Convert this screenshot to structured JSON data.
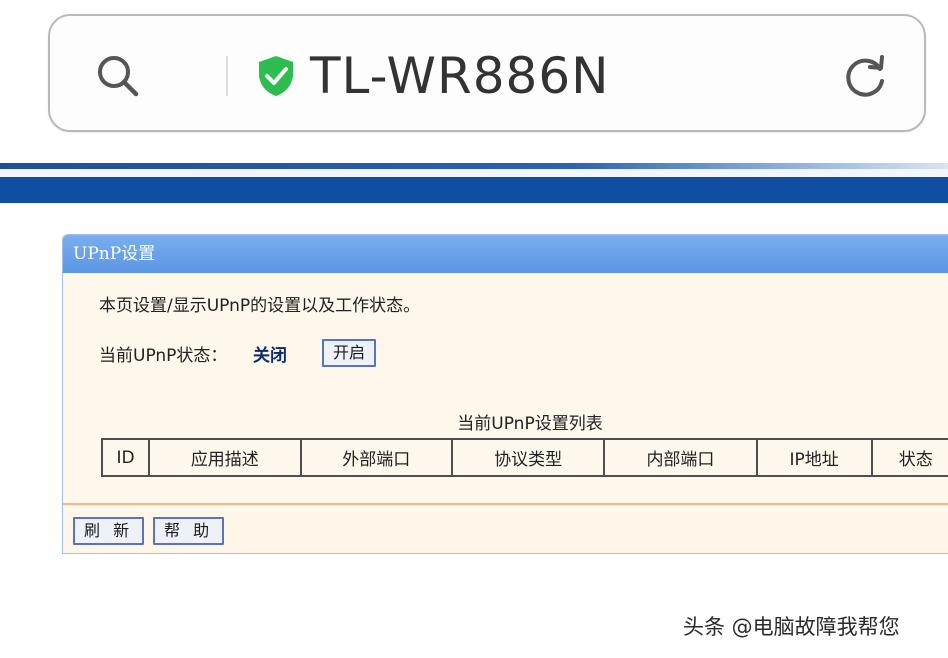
{
  "address_bar": {
    "title": "TL-WR886N",
    "icons": {
      "search": "search-icon",
      "secure": "shield-check-icon",
      "reload": "reload-icon"
    },
    "colors": {
      "shield": "#2dbd4e",
      "title": "#333333"
    }
  },
  "panel": {
    "title": "UPnP设置",
    "description": "本页设置/显示UPnP的设置以及工作状态。",
    "status_label": "当前UPnP状态：",
    "status_value": "关闭",
    "enable_button": "开启",
    "list_caption": "当前UPnP设置列表",
    "table_headers": [
      "ID",
      "应用描述",
      "外部端口",
      "协议类型",
      "内部端口",
      "IP地址",
      "状态"
    ],
    "refresh_button": "刷 新",
    "help_button": "帮 助",
    "colors": {
      "header_blue": "#5b95e2",
      "body_bg": "#fdf7ec",
      "status_value": "#0b2b6b",
      "top_stripe": "#0f4ea2"
    }
  },
  "watermark": "头条 @电脑故障我帮您"
}
